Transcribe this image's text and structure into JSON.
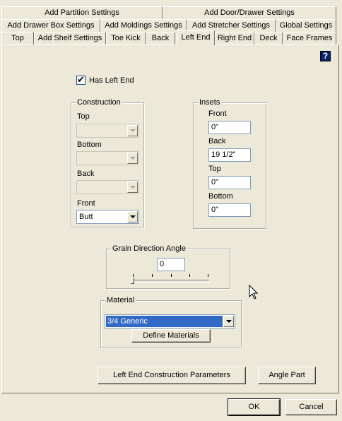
{
  "tabs_row1": [
    "Add Partition Settings",
    "Add Door/Drawer Settings"
  ],
  "tabs_row2": [
    "Add Drawer Box Settings",
    "Add Moldings Settings",
    "Add Stretcher Settings",
    "Global Settings"
  ],
  "tabs_row3": [
    "Top",
    "Add Shelf Settings",
    "Toe Kick",
    "Back",
    "Left End",
    "Right End",
    "Deck",
    "Face Frames"
  ],
  "active_tab": "Left End",
  "help_icon": "?",
  "has_left_end": {
    "label": "Has Left End",
    "checked": true
  },
  "construction": {
    "title": "Construction",
    "top_label": "Top",
    "top_value": "",
    "bottom_label": "Bottom",
    "bottom_value": "",
    "back_label": "Back",
    "back_value": "",
    "front_label": "Front",
    "front_value": "Butt"
  },
  "insets": {
    "title": "Insets",
    "front_label": "Front",
    "front_value": "0\"",
    "back_label": "Back",
    "back_value": "19 1/2\"",
    "top_label": "Top",
    "top_value": "0\"",
    "bottom_label": "Bottom",
    "bottom_value": "0\""
  },
  "grain": {
    "title": "Grain Direction Angle",
    "value": "0"
  },
  "material": {
    "title": "Material",
    "selected": "3/4 Generic",
    "define_button": "Define Materials"
  },
  "buttons": {
    "construction_params": "Left End Construction Parameters",
    "angle_part": "Angle Part",
    "ok": "OK",
    "cancel": "Cancel"
  },
  "colors": {
    "background": "#ece9d8",
    "selection": "#316ac5",
    "help_icon_bg": "#0a246a"
  }
}
